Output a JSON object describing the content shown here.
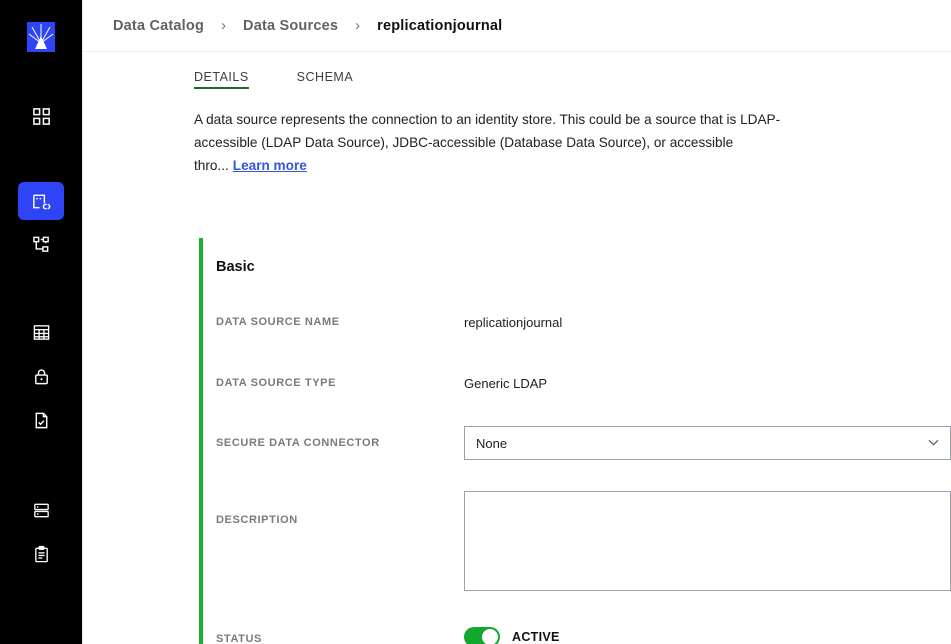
{
  "sidebar": {
    "logo": {
      "name": "app-logo",
      "color": "#2f44f5"
    },
    "items": [
      {
        "icon": "dashboard-grid-icon",
        "label": "Dashboard",
        "active": false
      },
      {
        "icon": "data-source-link-icon",
        "label": "Data Sources",
        "active": true
      },
      {
        "icon": "hierarchy-sitemap-icon",
        "label": "Hierarchy",
        "active": false
      },
      {
        "icon": "table-grid-icon",
        "label": "Tables",
        "active": false
      },
      {
        "icon": "lock-icon",
        "label": "Security",
        "active": false
      },
      {
        "icon": "document-check-icon",
        "label": "Policies",
        "active": false
      },
      {
        "icon": "server-stack-icon",
        "label": "Servers",
        "active": false
      },
      {
        "icon": "clipboard-list-icon",
        "label": "Reports",
        "active": false
      }
    ]
  },
  "breadcrumb": {
    "items": [
      "Data Catalog",
      "Data Sources",
      "replicationjournal"
    ],
    "separator": "›"
  },
  "tabs": [
    {
      "label": "DETAILS",
      "active": true
    },
    {
      "label": "SCHEMA",
      "active": false
    }
  ],
  "intro": {
    "text": "A data source represents the connection to an identity store. This could be a source that is LDAP-accessible (LDAP Data Source), JDBC-accessible (Database Data Source), or accessible thro...",
    "learn_more": "Learn more",
    "link_color": "#3355dd"
  },
  "form": {
    "section_title": "Basic",
    "accent_color": "#18b236",
    "fields": {
      "data_source_name": {
        "label": "DATA SOURCE NAME",
        "value": "replicationjournal"
      },
      "data_source_type": {
        "label": "DATA SOURCE TYPE",
        "value": "Generic LDAP"
      },
      "secure_data_connector": {
        "label": "SECURE DATA CONNECTOR",
        "value": "None",
        "options": [
          "None"
        ],
        "chevron": "⌄"
      },
      "description": {
        "label": "DESCRIPTION",
        "value": "",
        "placeholder": ""
      },
      "status": {
        "label": "STATUS",
        "state_label": "ACTIVE",
        "on": true,
        "on_color": "#11a82c"
      }
    }
  }
}
